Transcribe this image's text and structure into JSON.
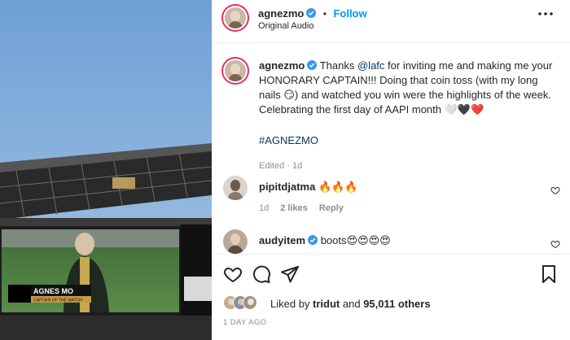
{
  "header": {
    "username": "agnezmo",
    "separator": "•",
    "follow_label": "Follow",
    "subtitle": "Original Audio",
    "more_icon": "more-horizontal-icon"
  },
  "caption": {
    "username": "agnezmo",
    "text_1": "Thanks ",
    "mention": "@lafc",
    "text_2": " for inviting me and making me your HONORARY CAPTAIN!!! Doing that coin toss (with my long nails 😏) and watched you win were the highlights of the week. Celebrating the first day of AAPI month 🤍🖤❤️",
    "hashtag": "#AGNEZMO",
    "edited": "Edited · 1d"
  },
  "comments": [
    {
      "username": "pipitdjatma",
      "text": "🔥🔥🔥",
      "time": "1d",
      "likes": "2 likes",
      "reply": "Reply"
    },
    {
      "username": "audyitem",
      "text": "boots😍😍😍😍",
      "time": "",
      "likes": "",
      "reply": ""
    }
  ],
  "actions": {
    "icons": [
      "heart-icon",
      "comment-icon",
      "share-icon",
      "bookmark-icon"
    ]
  },
  "likes": {
    "prefix": "Liked by ",
    "user": "tridut",
    "middle": " and ",
    "others": "95,011 others"
  },
  "timestamp": "1 DAY AGO",
  "media": {
    "scoreboard_name": "AGNES MO",
    "scoreboard_sub": "CAPTAIN OF THE MATCH"
  },
  "colors": {
    "follow": "#0095f6",
    "mention": "#00376b",
    "muted": "#8e8e8e",
    "verified": "#3897f0"
  }
}
